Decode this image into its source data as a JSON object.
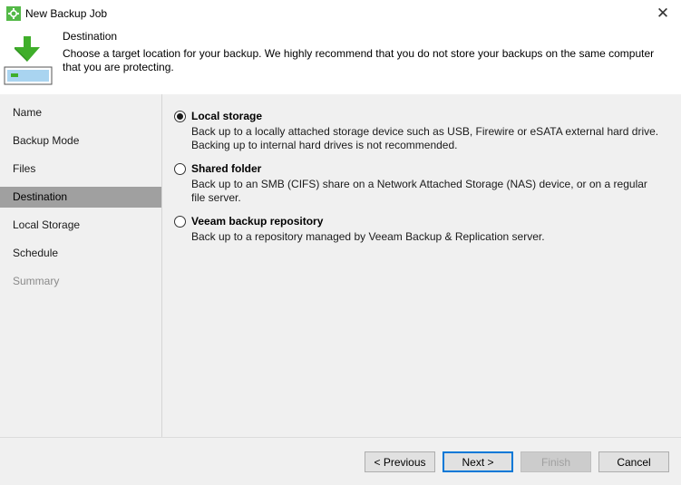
{
  "window": {
    "title": "New Backup Job",
    "close_symbol": "✕"
  },
  "header": {
    "title": "Destination",
    "description": "Choose a target location for your backup. We highly recommend that you do not store your backups on the same computer that you are protecting.",
    "icon": "download-drive-icon"
  },
  "nav": {
    "items": [
      {
        "label": "Name",
        "state": "normal"
      },
      {
        "label": "Backup Mode",
        "state": "normal"
      },
      {
        "label": "Files",
        "state": "normal"
      },
      {
        "label": "Destination",
        "state": "active"
      },
      {
        "label": "Local Storage",
        "state": "normal"
      },
      {
        "label": "Schedule",
        "state": "normal"
      },
      {
        "label": "Summary",
        "state": "disabled"
      }
    ]
  },
  "options": [
    {
      "label": "Local storage",
      "description": "Back up to a locally attached storage device such as USB, Firewire or eSATA external hard drive. Backing up to internal hard drives is not recommended.",
      "checked": true
    },
    {
      "label": "Shared folder",
      "description": "Back up to an SMB (CIFS) share on a Network Attached Storage (NAS) device, or on a regular file server.",
      "checked": false
    },
    {
      "label": "Veeam backup repository",
      "description": "Back up to a repository managed by Veeam Backup & Replication server.",
      "checked": false
    }
  ],
  "buttons": {
    "previous": "< Previous",
    "next": "Next >",
    "finish": "Finish",
    "cancel": "Cancel"
  },
  "colors": {
    "accent": "#0078d7",
    "brand_green": "#54b948",
    "nav_active": "#a0a0a0"
  }
}
